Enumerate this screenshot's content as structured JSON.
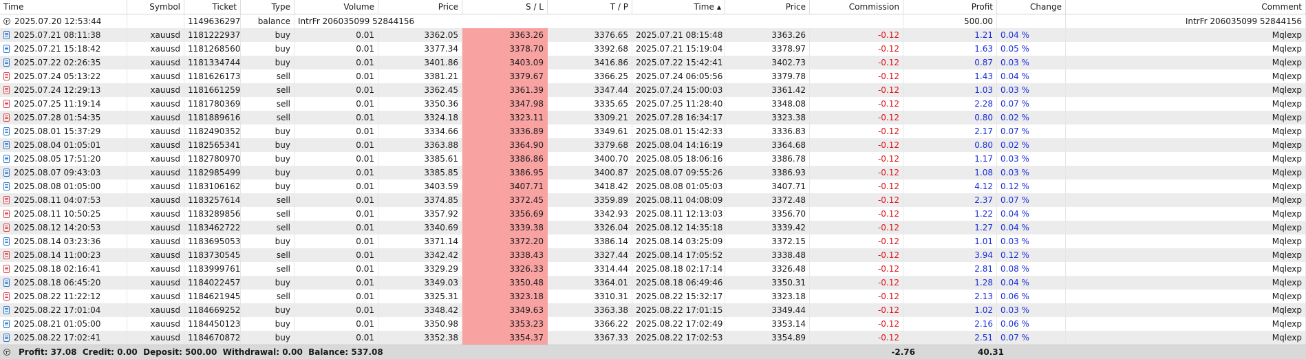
{
  "columns": {
    "time": "Time",
    "symbol": "Symbol",
    "ticket": "Ticket",
    "type": "Type",
    "volume": "Volume",
    "price": "Price",
    "sl": "S / L",
    "tp": "T / P",
    "close_time": "Time",
    "close_price": "Price",
    "commission": "Commission",
    "profit": "Profit",
    "change": "Change",
    "comment": "Comment"
  },
  "balance_row": {
    "time": "2025.07.20 12:53:44",
    "ticket": "1149636297",
    "type": "balance",
    "comment_left": "IntrFr 206035099 52844156",
    "profit": "500.00",
    "comment": "IntrFr 206035099 52844156"
  },
  "rows": [
    {
      "time": "2025.07.21 08:11:38",
      "symbol": "xauusd",
      "ticket": "1181222937",
      "type": "buy",
      "volume": "0.01",
      "price": "3362.05",
      "sl": "3363.26",
      "tp": "3376.65",
      "close_time": "2025.07.21 08:15:48",
      "close_price": "3363.26",
      "commission": "-0.12",
      "profit": "1.21",
      "change": "0.04 %",
      "comment": "Mqlexp"
    },
    {
      "time": "2025.07.21 15:18:42",
      "symbol": "xauusd",
      "ticket": "1181268560",
      "type": "buy",
      "volume": "0.01",
      "price": "3377.34",
      "sl": "3378.70",
      "tp": "3392.68",
      "close_time": "2025.07.21 15:19:04",
      "close_price": "3378.97",
      "commission": "-0.12",
      "profit": "1.63",
      "change": "0.05 %",
      "comment": "Mqlexp"
    },
    {
      "time": "2025.07.22 02:26:35",
      "symbol": "xauusd",
      "ticket": "1181334744",
      "type": "buy",
      "volume": "0.01",
      "price": "3401.86",
      "sl": "3403.09",
      "tp": "3416.86",
      "close_time": "2025.07.22 15:42:41",
      "close_price": "3402.73",
      "commission": "-0.12",
      "profit": "0.87",
      "change": "0.03 %",
      "comment": "Mqlexp"
    },
    {
      "time": "2025.07.24 05:13:22",
      "symbol": "xauusd",
      "ticket": "1181626173",
      "type": "sell",
      "volume": "0.01",
      "price": "3381.21",
      "sl": "3379.67",
      "tp": "3366.25",
      "close_time": "2025.07.24 06:05:56",
      "close_price": "3379.78",
      "commission": "-0.12",
      "profit": "1.43",
      "change": "0.04 %",
      "comment": "Mqlexp"
    },
    {
      "time": "2025.07.24 12:29:13",
      "symbol": "xauusd",
      "ticket": "1181661259",
      "type": "sell",
      "volume": "0.01",
      "price": "3362.45",
      "sl": "3361.39",
      "tp": "3347.44",
      "close_time": "2025.07.24 15:00:03",
      "close_price": "3361.42",
      "commission": "-0.12",
      "profit": "1.03",
      "change": "0.03 %",
      "comment": "Mqlexp"
    },
    {
      "time": "2025.07.25 11:19:14",
      "symbol": "xauusd",
      "ticket": "1181780369",
      "type": "sell",
      "volume": "0.01",
      "price": "3350.36",
      "sl": "3347.98",
      "tp": "3335.65",
      "close_time": "2025.07.25 11:28:40",
      "close_price": "3348.08",
      "commission": "-0.12",
      "profit": "2.28",
      "change": "0.07 %",
      "comment": "Mqlexp"
    },
    {
      "time": "2025.07.28 01:54:35",
      "symbol": "xauusd",
      "ticket": "1181889616",
      "type": "sell",
      "volume": "0.01",
      "price": "3324.18",
      "sl": "3323.11",
      "tp": "3309.21",
      "close_time": "2025.07.28 16:34:17",
      "close_price": "3323.38",
      "commission": "-0.12",
      "profit": "0.80",
      "change": "0.02 %",
      "comment": "Mqlexp"
    },
    {
      "time": "2025.08.01 15:37:29",
      "symbol": "xauusd",
      "ticket": "1182490352",
      "type": "buy",
      "volume": "0.01",
      "price": "3334.66",
      "sl": "3336.89",
      "tp": "3349.61",
      "close_time": "2025.08.01 15:42:33",
      "close_price": "3336.83",
      "commission": "-0.12",
      "profit": "2.17",
      "change": "0.07 %",
      "comment": "Mqlexp"
    },
    {
      "time": "2025.08.04 01:05:01",
      "symbol": "xauusd",
      "ticket": "1182565341",
      "type": "buy",
      "volume": "0.01",
      "price": "3363.88",
      "sl": "3364.90",
      "tp": "3379.68",
      "close_time": "2025.08.04 14:16:19",
      "close_price": "3364.68",
      "commission": "-0.12",
      "profit": "0.80",
      "change": "0.02 %",
      "comment": "Mqlexp"
    },
    {
      "time": "2025.08.05 17:51:20",
      "symbol": "xauusd",
      "ticket": "1182780970",
      "type": "buy",
      "volume": "0.01",
      "price": "3385.61",
      "sl": "3386.86",
      "tp": "3400.70",
      "close_time": "2025.08.05 18:06:16",
      "close_price": "3386.78",
      "commission": "-0.12",
      "profit": "1.17",
      "change": "0.03 %",
      "comment": "Mqlexp"
    },
    {
      "time": "2025.08.07 09:43:03",
      "symbol": "xauusd",
      "ticket": "1182985499",
      "type": "buy",
      "volume": "0.01",
      "price": "3385.85",
      "sl": "3386.95",
      "tp": "3400.87",
      "close_time": "2025.08.07 09:55:26",
      "close_price": "3386.93",
      "commission": "-0.12",
      "profit": "1.08",
      "change": "0.03 %",
      "comment": "Mqlexp"
    },
    {
      "time": "2025.08.08 01:05:00",
      "symbol": "xauusd",
      "ticket": "1183106162",
      "type": "buy",
      "volume": "0.01",
      "price": "3403.59",
      "sl": "3407.71",
      "tp": "3418.42",
      "close_time": "2025.08.08 01:05:03",
      "close_price": "3407.71",
      "commission": "-0.12",
      "profit": "4.12",
      "change": "0.12 %",
      "comment": "Mqlexp"
    },
    {
      "time": "2025.08.11 04:07:53",
      "symbol": "xauusd",
      "ticket": "1183257614",
      "type": "sell",
      "volume": "0.01",
      "price": "3374.85",
      "sl": "3372.45",
      "tp": "3359.89",
      "close_time": "2025.08.11 04:08:09",
      "close_price": "3372.48",
      "commission": "-0.12",
      "profit": "2.37",
      "change": "0.07 %",
      "comment": "Mqlexp"
    },
    {
      "time": "2025.08.11 10:50:25",
      "symbol": "xauusd",
      "ticket": "1183289856",
      "type": "sell",
      "volume": "0.01",
      "price": "3357.92",
      "sl": "3356.69",
      "tp": "3342.93",
      "close_time": "2025.08.11 12:13:03",
      "close_price": "3356.70",
      "commission": "-0.12",
      "profit": "1.22",
      "change": "0.04 %",
      "comment": "Mqlexp"
    },
    {
      "time": "2025.08.12 14:20:53",
      "symbol": "xauusd",
      "ticket": "1183462722",
      "type": "sell",
      "volume": "0.01",
      "price": "3340.69",
      "sl": "3339.38",
      "tp": "3326.04",
      "close_time": "2025.08.12 14:35:18",
      "close_price": "3339.42",
      "commission": "-0.12",
      "profit": "1.27",
      "change": "0.04 %",
      "comment": "Mqlexp"
    },
    {
      "time": "2025.08.14 03:23:36",
      "symbol": "xauusd",
      "ticket": "1183695053",
      "type": "buy",
      "volume": "0.01",
      "price": "3371.14",
      "sl": "3372.20",
      "tp": "3386.14",
      "close_time": "2025.08.14 03:25:09",
      "close_price": "3372.15",
      "commission": "-0.12",
      "profit": "1.01",
      "change": "0.03 %",
      "comment": "Mqlexp"
    },
    {
      "time": "2025.08.14 11:00:23",
      "symbol": "xauusd",
      "ticket": "1183730545",
      "type": "sell",
      "volume": "0.01",
      "price": "3342.42",
      "sl": "3338.43",
      "tp": "3327.44",
      "close_time": "2025.08.14 17:05:52",
      "close_price": "3338.48",
      "commission": "-0.12",
      "profit": "3.94",
      "change": "0.12 %",
      "comment": "Mqlexp"
    },
    {
      "time": "2025.08.18 02:16:41",
      "symbol": "xauusd",
      "ticket": "1183999761",
      "type": "sell",
      "volume": "0.01",
      "price": "3329.29",
      "sl": "3326.33",
      "tp": "3314.44",
      "close_time": "2025.08.18 02:17:14",
      "close_price": "3326.48",
      "commission": "-0.12",
      "profit": "2.81",
      "change": "0.08 %",
      "comment": "Mqlexp"
    },
    {
      "time": "2025.08.18 06:45:20",
      "symbol": "xauusd",
      "ticket": "1184022457",
      "type": "buy",
      "volume": "0.01",
      "price": "3349.03",
      "sl": "3350.48",
      "tp": "3364.01",
      "close_time": "2025.08.18 06:49:46",
      "close_price": "3350.31",
      "commission": "-0.12",
      "profit": "1.28",
      "change": "0.04 %",
      "comment": "Mqlexp"
    },
    {
      "time": "2025.08.22 11:22:12",
      "symbol": "xauusd",
      "ticket": "1184621945",
      "type": "sell",
      "volume": "0.01",
      "price": "3325.31",
      "sl": "3323.18",
      "tp": "3310.31",
      "close_time": "2025.08.22 15:32:17",
      "close_price": "3323.18",
      "commission": "-0.12",
      "profit": "2.13",
      "change": "0.06 %",
      "comment": "Mqlexp"
    },
    {
      "time": "2025.08.22 17:01:04",
      "symbol": "xauusd",
      "ticket": "1184669252",
      "type": "buy",
      "volume": "0.01",
      "price": "3348.42",
      "sl": "3349.63",
      "tp": "3363.38",
      "close_time": "2025.08.22 17:01:15",
      "close_price": "3349.44",
      "commission": "-0.12",
      "profit": "1.02",
      "change": "0.03 %",
      "comment": "Mqlexp"
    },
    {
      "time": "2025.08.21 01:05:00",
      "symbol": "xauusd",
      "ticket": "1184450123",
      "type": "buy",
      "volume": "0.01",
      "price": "3350.98",
      "sl": "3353.23",
      "tp": "3366.22",
      "close_time": "2025.08.22 17:02:49",
      "close_price": "3353.14",
      "commission": "-0.12",
      "profit": "2.16",
      "change": "0.06 %",
      "comment": "Mqlexp"
    },
    {
      "time": "2025.08.22 17:02:41",
      "symbol": "xauusd",
      "ticket": "1184670872",
      "type": "buy",
      "volume": "0.01",
      "price": "3352.38",
      "sl": "3354.37",
      "tp": "3367.33",
      "close_time": "2025.08.22 17:02:53",
      "close_price": "3354.89",
      "commission": "-0.12",
      "profit": "2.51",
      "change": "0.07 %",
      "comment": "Mqlexp"
    }
  ],
  "footer": {
    "summary": "Profit: 37.08  Credit: 0.00  Deposit: 500.00  Withdrawal: 0.00  Balance: 537.08",
    "commission_total": "-2.76",
    "profit_total": "40.31"
  },
  "colors": {
    "sl_highlight": "#f8a2a2",
    "negative": "#e0161c",
    "positive": "#1b2fd9",
    "buy_icon": "#2f7ad3",
    "sell_icon": "#e0484d"
  },
  "icons": {
    "buy": "buy-order-icon",
    "sell": "sell-order-icon",
    "balance": "plus-circle-icon",
    "sort": "sort-ascending-icon"
  }
}
